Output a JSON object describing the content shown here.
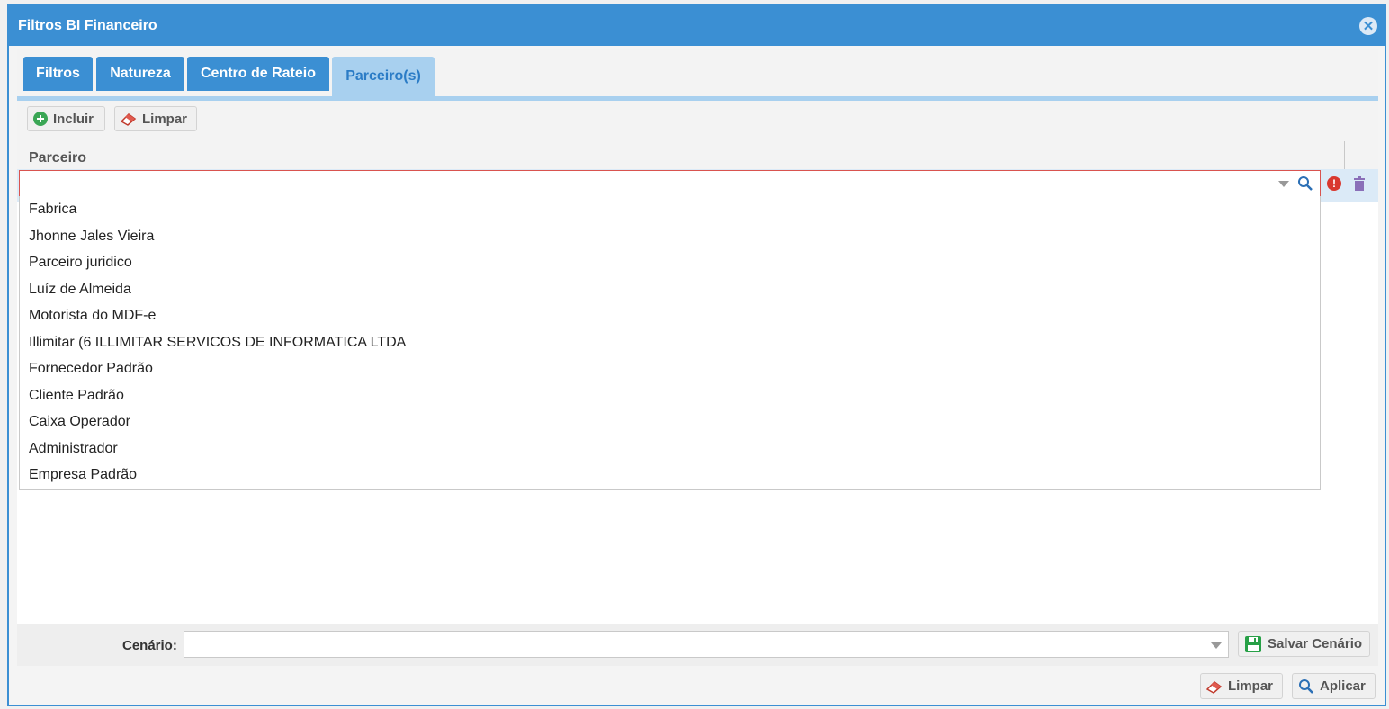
{
  "dialog": {
    "title": "Filtros BI Financeiro"
  },
  "tabs": [
    {
      "label": "Filtros",
      "active": false
    },
    {
      "label": "Natureza",
      "active": false
    },
    {
      "label": "Centro de Rateio",
      "active": false
    },
    {
      "label": "Parceiro(s)",
      "active": true
    }
  ],
  "toolbar": {
    "include_label": "Incluir",
    "clear_label": "Limpar"
  },
  "grid": {
    "column_header": "Parceiro",
    "combo_value": ""
  },
  "dropdown": {
    "options": [
      "Fabrica",
      "Jhonne Jales Vieira",
      "Parceiro juridico",
      "Luíz de Almeida",
      "Motorista do MDF-e",
      "Illimitar (6 ILLIMITAR SERVICOS DE INFORMATICA LTDA",
      "Fornecedor Padrão",
      "Cliente Padrão",
      "Caixa Operador",
      "Administrador",
      "Empresa Padrão"
    ]
  },
  "footer": {
    "scenario_label": "Cenário:",
    "scenario_value": "",
    "save_scenario_label": "Salvar Cenário",
    "clear_label": "Limpar",
    "apply_label": "Aplicar"
  },
  "colors": {
    "accent": "#3b8fd3",
    "tab_active": "#a8d0ef",
    "error": "#d9382f"
  }
}
